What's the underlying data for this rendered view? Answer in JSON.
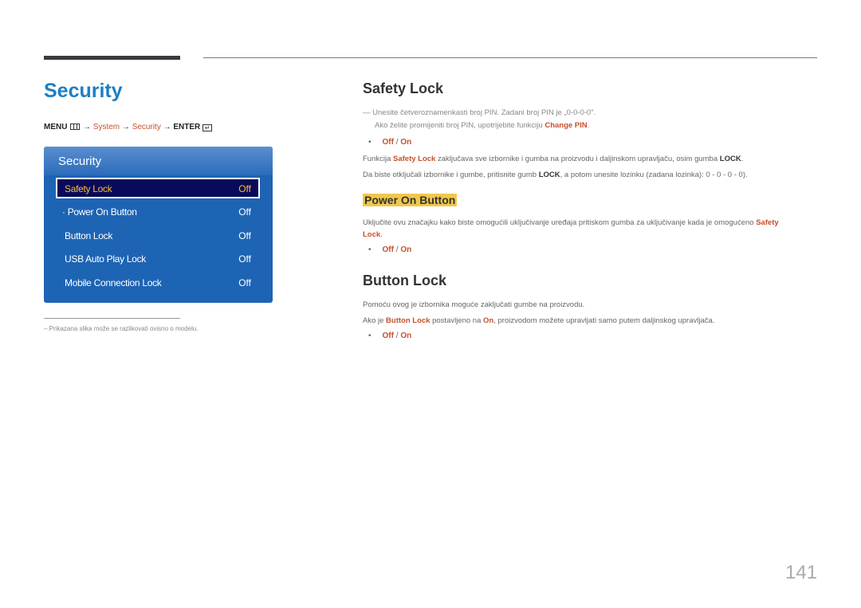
{
  "page_title": "Security",
  "menu_path": {
    "menu": "MENU",
    "arrow": "→",
    "system": "System",
    "security": "Security",
    "enter": "ENTER"
  },
  "osd": {
    "title": "Security",
    "items": [
      {
        "label": "Safety Lock",
        "value": "Off",
        "selected": true
      },
      {
        "label": "· Power On Button",
        "value": "Off"
      },
      {
        "label": "Button Lock",
        "value": "Off"
      },
      {
        "label": "USB Auto Play Lock",
        "value": "Off"
      },
      {
        "label": "Mobile Connection Lock",
        "value": "Off"
      }
    ]
  },
  "footnote": "–  Prikazana slika može se razlikovati ovisno o modelu.",
  "safety_lock": {
    "heading": "Safety Lock",
    "note_line1": "Unesite četveroznamenkasti broj PIN. Zadani broj PIN je „0-0-0-0\".",
    "note_line2_prefix": "Ako želite promijeniti broj PIN, upotrijebite funkciju ",
    "note_line2_link": "Change PIN",
    "options_off": "Off",
    "options_sep": " / ",
    "options_on": "On",
    "p1_prefix": "Funkcija ",
    "p1_link": "Safety Lock",
    "p1_mid": " zaključava sve izbornike i gumba na proizvodu i daljinskom upravljaču, osim gumba ",
    "p1_bold": "LOCK",
    "p2_prefix": "Da biste otključali izbornike i gumbe, pritisnite gumb ",
    "p2_bold": "LOCK",
    "p2_suffix": ", a potom unesite lozinku (zadana lozinka): 0 - 0 - 0 - 0)."
  },
  "power_on_button": {
    "heading": "Power On Button",
    "p1": "Uključite ovu značajku kako biste omogućili uključivanje uređaja pritiskom gumba za uključivanje kada je omogućeno ",
    "p1_link1": "Safety",
    "p1_link2": "Lock",
    "options_off": "Off",
    "options_on": "On"
  },
  "button_lock": {
    "heading": "Button Lock",
    "p1": "Pomoću ovog je izbornika moguće zaključati gumbe na proizvodu.",
    "p2_prefix": "Ako je ",
    "p2_link": "Button Lock",
    "p2_mid": " postavljeno na ",
    "p2_on": "On",
    "p2_suffix": ", proizvodom možete upravljati samo putem daljinskog upravljača.",
    "options_off": "Off",
    "options_on": "On"
  },
  "page_number": "141",
  "colors": {
    "accent": "#c8502a",
    "title_blue": "#1c7fc4",
    "osd_blue": "#1e64b4",
    "highlight": "#f0c84a"
  }
}
